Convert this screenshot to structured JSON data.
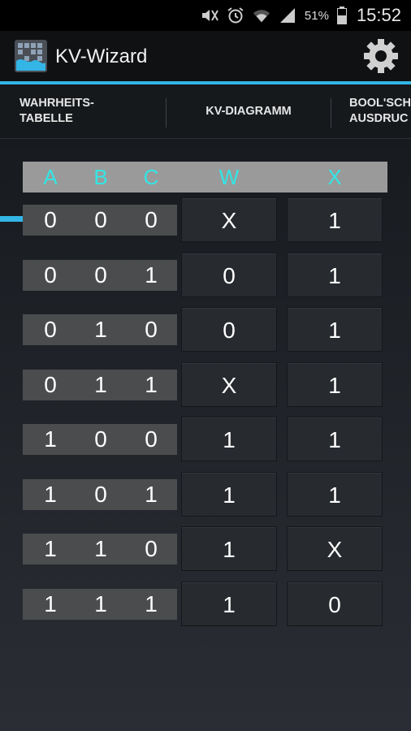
{
  "status": {
    "battery": "51%",
    "time": "15:52"
  },
  "app": {
    "title": "KV-Wizard"
  },
  "tabs": [
    {
      "line1": "WAHRHEITS-",
      "line2": "TABELLE"
    },
    {
      "line1": "KV-DIAGRAMM",
      "line2": ""
    },
    {
      "line1": "BOOL'SCH",
      "line2": "AUSDRUC"
    }
  ],
  "table": {
    "headers": [
      "A",
      "B",
      "C",
      "W",
      "X"
    ],
    "rows": [
      {
        "inputs": [
          "0",
          "0",
          "0"
        ],
        "W": "X",
        "X": "1"
      },
      {
        "inputs": [
          "0",
          "0",
          "1"
        ],
        "W": "0",
        "X": "1"
      },
      {
        "inputs": [
          "0",
          "1",
          "0"
        ],
        "W": "0",
        "X": "1"
      },
      {
        "inputs": [
          "0",
          "1",
          "1"
        ],
        "W": "X",
        "X": "1"
      },
      {
        "inputs": [
          "1",
          "0",
          "0"
        ],
        "W": "1",
        "X": "1"
      },
      {
        "inputs": [
          "1",
          "0",
          "1"
        ],
        "W": "1",
        "X": "1"
      },
      {
        "inputs": [
          "1",
          "1",
          "0"
        ],
        "W": "1",
        "X": "X"
      },
      {
        "inputs": [
          "1",
          "1",
          "1"
        ],
        "W": "1",
        "X": "0"
      }
    ]
  }
}
